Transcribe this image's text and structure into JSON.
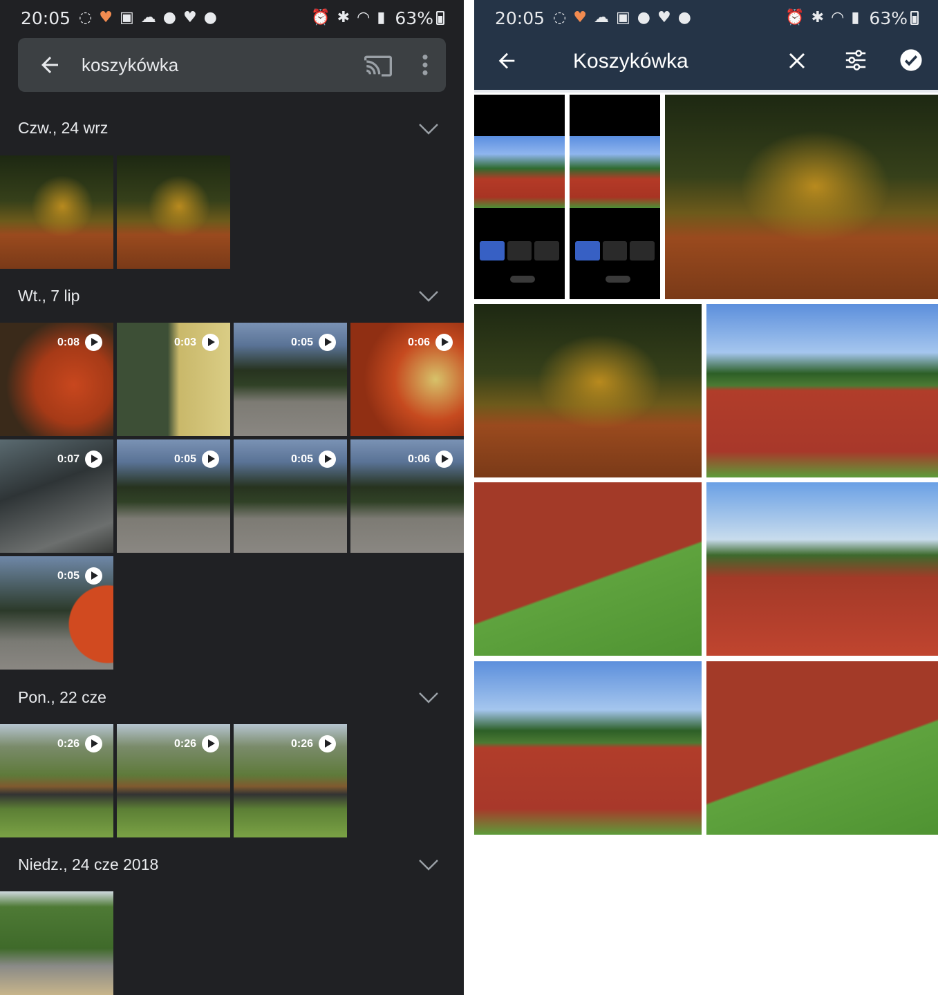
{
  "status_bar": {
    "time": "20:05",
    "battery": "63%"
  },
  "left": {
    "search": {
      "query": "koszykówka"
    },
    "sections": [
      {
        "title": "Czw., 24 wrz",
        "items": [
          {
            "duration": ""
          },
          {
            "duration": ""
          }
        ]
      },
      {
        "title": "Wt., 7 lip",
        "items": [
          {
            "duration": "0:08"
          },
          {
            "duration": "0:03"
          },
          {
            "duration": "0:05"
          },
          {
            "duration": "0:06"
          },
          {
            "duration": "0:07"
          },
          {
            "duration": "0:05"
          },
          {
            "duration": "0:05"
          },
          {
            "duration": "0:06"
          },
          {
            "duration": "0:05"
          }
        ]
      },
      {
        "title": "Pon., 22 cze",
        "items": [
          {
            "duration": "0:26"
          },
          {
            "duration": "0:26"
          },
          {
            "duration": "0:26"
          }
        ]
      },
      {
        "title": "Niedz., 24 cze 2018",
        "items": [
          {
            "duration": ""
          }
        ]
      }
    ]
  },
  "right": {
    "title": "Koszykówka"
  },
  "colors": {
    "left_bg": "#202124",
    "search_bg": "#3c4043",
    "right_header_bg": "#253447"
  }
}
